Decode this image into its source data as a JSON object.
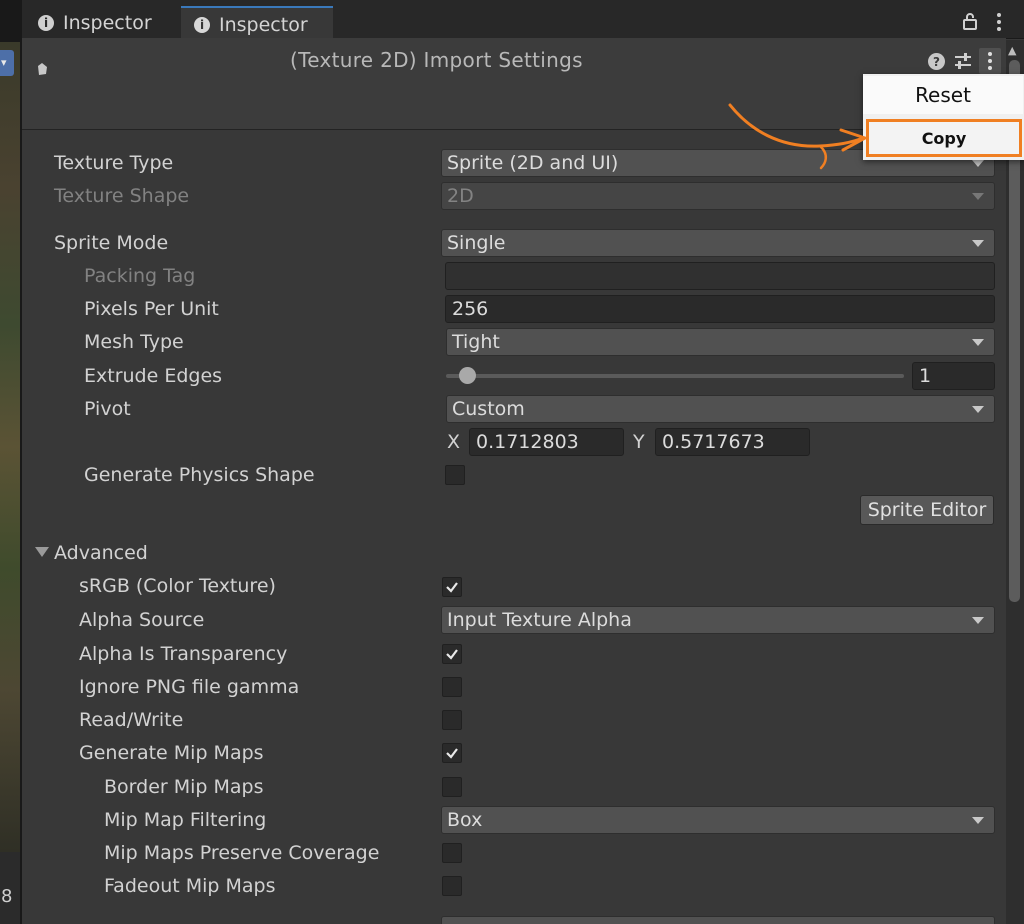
{
  "tabs": [
    {
      "label": "Inspector",
      "icon": "info-icon"
    },
    {
      "label": "Inspector",
      "icon": "info-icon",
      "active": true
    }
  ],
  "header": {
    "title": "(Texture 2D) Import Settings"
  },
  "context_menu": {
    "items": [
      {
        "label": "Reset"
      },
      {
        "label": "Copy",
        "highlighted": true
      }
    ]
  },
  "properties": {
    "texture_type": {
      "label": "Texture Type",
      "value": "Sprite (2D and UI)"
    },
    "texture_shape": {
      "label": "Texture Shape",
      "value": "2D"
    },
    "sprite_mode": {
      "label": "Sprite Mode",
      "value": "Single"
    },
    "packing_tag": {
      "label": "Packing Tag",
      "value": ""
    },
    "pixels_per_unit": {
      "label": "Pixels Per Unit",
      "value": "256"
    },
    "mesh_type": {
      "label": "Mesh Type",
      "value": "Tight"
    },
    "extrude_edges": {
      "label": "Extrude Edges",
      "value": "1",
      "slider_fraction": 0.0
    },
    "pivot": {
      "label": "Pivot",
      "value": "Custom",
      "x_label": "X",
      "x": "0.1712803",
      "y_label": "Y",
      "y": "0.5717673"
    },
    "generate_physics_shape": {
      "label": "Generate Physics Shape",
      "checked": false
    },
    "sprite_editor_button": "Sprite Editor"
  },
  "advanced": {
    "label": "Advanced",
    "srgb": {
      "label": "sRGB (Color Texture)",
      "checked": true
    },
    "alpha_source": {
      "label": "Alpha Source",
      "value": "Input Texture Alpha"
    },
    "alpha_is_transparency": {
      "label": "Alpha Is Transparency",
      "checked": true
    },
    "ignore_png_gamma": {
      "label": "Ignore PNG file gamma",
      "checked": false
    },
    "read_write": {
      "label": "Read/Write",
      "checked": false
    },
    "generate_mip_maps": {
      "label": "Generate Mip Maps",
      "checked": true
    },
    "border_mip_maps": {
      "label": "Border Mip Maps",
      "checked": false
    },
    "mip_map_filtering": {
      "label": "Mip Map Filtering",
      "value": "Box"
    },
    "mip_maps_preserve_coverage": {
      "label": "Mip Maps Preserve Coverage",
      "checked": false
    },
    "fadeout_mip_maps": {
      "label": "Fadeout Mip Maps",
      "checked": false
    }
  },
  "left_panel": {
    "digit": "8"
  },
  "colors": {
    "accent": "#3a79bb",
    "highlight_annotation": "#f07f22"
  }
}
